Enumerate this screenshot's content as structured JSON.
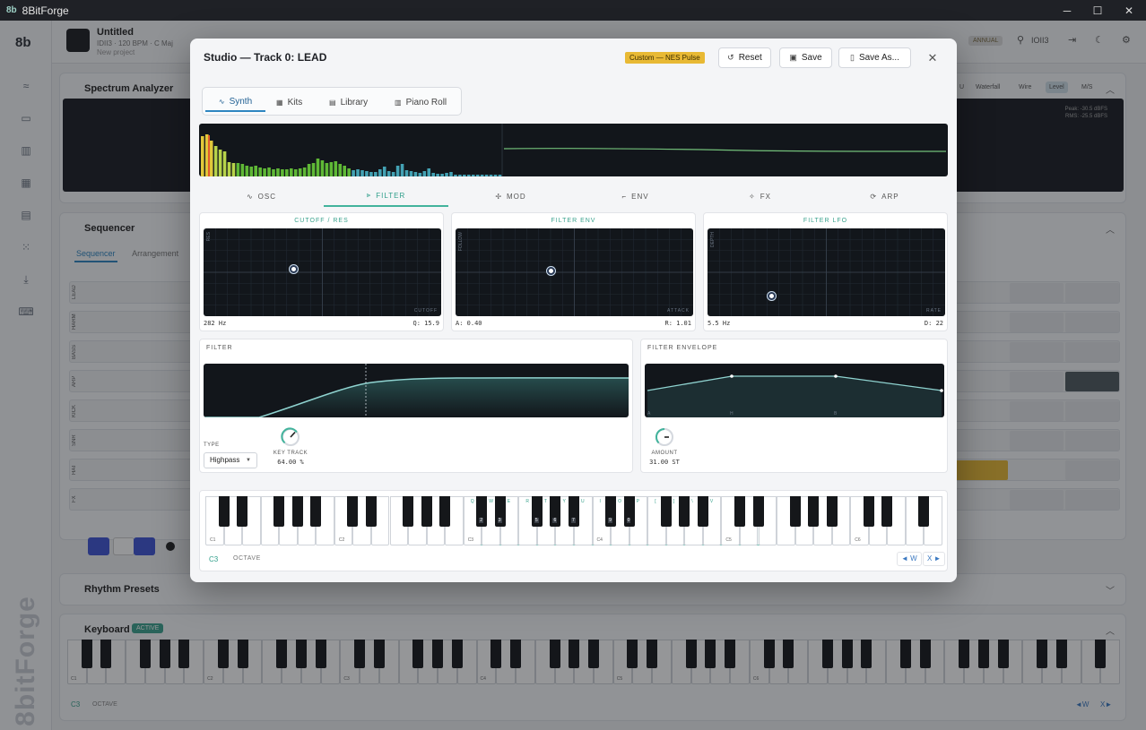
{
  "window": {
    "title": "8BitForge",
    "app_icon": "8b",
    "minimize": "─",
    "maximize": "☐",
    "close": "✕"
  },
  "background": {
    "logo": "8b",
    "vertical_logo": "8bitForge",
    "project": {
      "title": "Untitled",
      "meta": "IDII3 · 120 BPM · C Maj",
      "sub": "New project"
    },
    "plan_badge": "ANNUAL",
    "user_label": "IOII3",
    "sections": {
      "spectrum": "Spectrum Analyzer",
      "sequencer": "Sequencer",
      "rhythm": "Rhythm Presets",
      "keyboard": "Keyboard"
    },
    "spectrum_readout": {
      "peak": "Peak: -30.5 dBFS",
      "rms": "RMS: -25.5 dBFS"
    },
    "view_pills": [
      "U",
      "Waterfall",
      "Wire",
      "Level",
      "M/S"
    ],
    "seq_tabs": [
      "Sequencer",
      "Arrangement"
    ],
    "tracks": [
      "LEAD",
      "HARM",
      "BASS",
      "ARP",
      "KICK",
      "SNR",
      "HAT",
      "FX"
    ],
    "keyboard_badge": "ACTIVE",
    "octave_label": "C3",
    "octave_text": "OCTAVE",
    "octave_down": "◄W",
    "octave_up": "X►",
    "key_labels": [
      "C1",
      "C2",
      "C3",
      "C4",
      "C5",
      "C6"
    ]
  },
  "modal": {
    "title": "Studio — Track 0: LEAD",
    "preset_badge": "Custom — NES Pulse",
    "buttons": {
      "reset": "Reset",
      "save": "Save",
      "save_as": "Save As..."
    },
    "close": "✕",
    "tabs": [
      {
        "label": "Synth",
        "icon": "wave-icon"
      },
      {
        "label": "Kits",
        "icon": "grid-icon"
      },
      {
        "label": "Library",
        "icon": "book-icon"
      },
      {
        "label": "Piano Roll",
        "icon": "piano-roll-icon"
      }
    ],
    "active_tab": "Synth",
    "subtabs": [
      {
        "label": "OSC",
        "icon": "osc-icon"
      },
      {
        "label": "FILTER",
        "icon": "filter-icon"
      },
      {
        "label": "MOD",
        "icon": "mod-icon"
      },
      {
        "label": "ENV",
        "icon": "env-icon"
      },
      {
        "label": "FX",
        "icon": "fx-icon"
      },
      {
        "label": "ARP",
        "icon": "arp-icon"
      }
    ],
    "active_subtab": "FILTER",
    "xy_pads": [
      {
        "title": "CUTOFF / RES",
        "y_axis": "RES",
        "x_axis": "CUTOFF",
        "left_value": "282 Hz",
        "right_value": "Q: 15.9",
        "x": 0.38,
        "y": 0.46
      },
      {
        "title": "FILTER ENV",
        "y_axis": "FOLLOW",
        "x_axis": "ATTACK",
        "left_value": "A: 0.40",
        "right_value": "R: 1.01",
        "x": 0.4,
        "y": 0.48
      },
      {
        "title": "FILTER LFO",
        "y_axis": "DEPTH",
        "x_axis": "RATE",
        "left_value": "5.5 Hz",
        "right_value": "D: 22",
        "x": 0.27,
        "y": 0.77
      }
    ],
    "filter_panel": {
      "title": "FILTER",
      "type_label": "TYPE",
      "type_value": "Highpass",
      "key_track_label": "KEY TRACK",
      "key_track_value": "64.00 %",
      "key_track_fraction": 0.64
    },
    "filter_envelope_panel": {
      "title": "FILTER ENVELOPE",
      "stage_labels": [
        "A",
        "H",
        "B"
      ],
      "amount_label": "AMOUNT",
      "amount_value": "31.00 ST",
      "amount_fraction": 0.5
    },
    "keyboard": {
      "octave_label": "C3",
      "octave_text": "OCTAVE",
      "octave_down": "◄ W",
      "octave_up": "X ►",
      "c_labels": [
        "C1",
        "C2",
        "C3",
        "C4",
        "C5",
        "C6"
      ],
      "white_hotkeys": [
        "Q",
        "W",
        "E",
        "R",
        "T",
        "Y",
        "U",
        "I",
        "O",
        "P",
        "[",
        "]",
        "\\",
        "V"
      ],
      "black_hotkeys": [
        "2",
        "3",
        "5",
        "6",
        "7",
        "9",
        "0"
      ]
    }
  },
  "colors": {
    "accent": "#42b39c",
    "preset_badge": "#e8b934",
    "tab_active": "#2e86c1",
    "transport": "#3e55d6"
  }
}
